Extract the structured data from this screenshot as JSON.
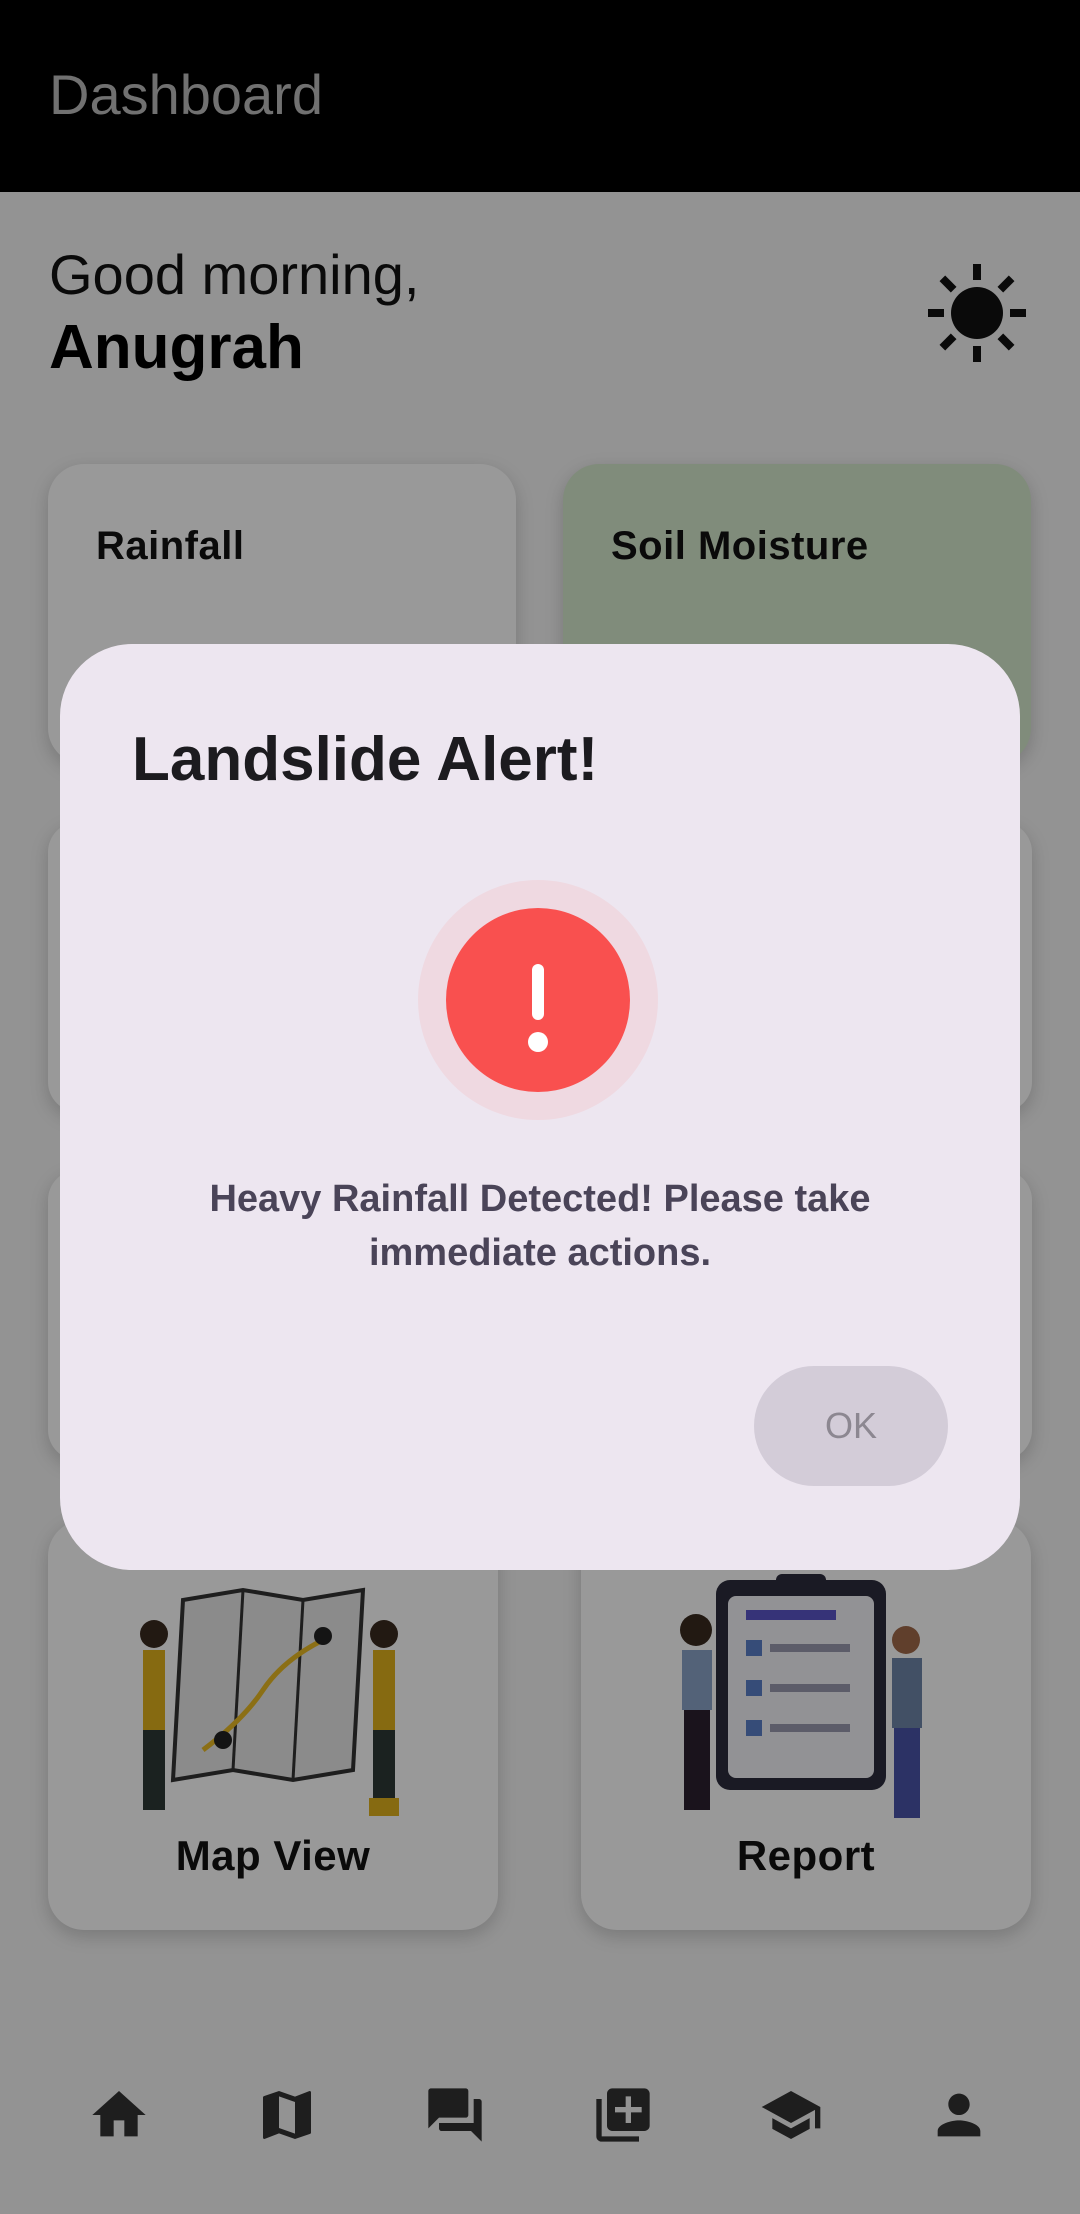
{
  "app_bar": {
    "title": "Dashboard"
  },
  "greeting": {
    "line": "Good morning,",
    "name": "Anugrah"
  },
  "stat_cards": [
    {
      "title": "Rainfall"
    },
    {
      "title": "Soil Moisture"
    }
  ],
  "feature_tiles": [
    {
      "label": "Map View"
    },
    {
      "label": "Report"
    }
  ],
  "bottom_nav": {
    "items": [
      {
        "icon": "home-icon"
      },
      {
        "icon": "map-icon"
      },
      {
        "icon": "chat-icon"
      },
      {
        "icon": "add-box-icon"
      },
      {
        "icon": "school-icon"
      },
      {
        "icon": "person-icon"
      }
    ]
  },
  "alert_dialog": {
    "title": "Landslide Alert!",
    "message": "Heavy Rainfall Detected!  Please take immediate actions.",
    "ok_label": "OK",
    "icon": "alert-exclamation-icon"
  },
  "colors": {
    "alert_red": "#f9504f",
    "dialog_bg": "#ede6f0",
    "soil_card": "#d6e9cd",
    "app_bar": "#000000"
  }
}
